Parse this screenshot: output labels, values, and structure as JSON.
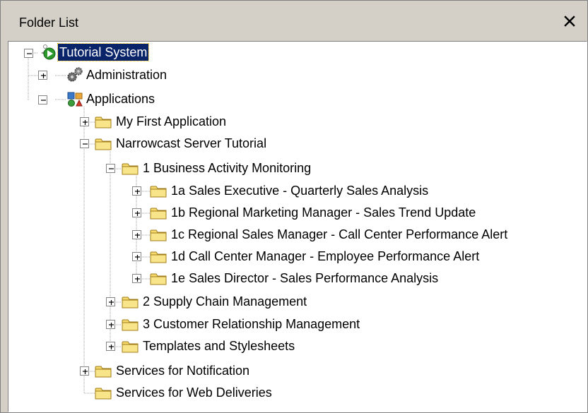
{
  "panel": {
    "title": "Folder List",
    "close_glyph": "✕"
  },
  "tree": {
    "root": {
      "label": "Tutorial System",
      "icon": "system-icon",
      "expanded": true,
      "selected": true
    },
    "administration": {
      "label": "Administration",
      "icon": "gears-icon",
      "expanded": false
    },
    "applications": {
      "label": "Applications",
      "icon": "applications-icon",
      "expanded": true
    },
    "my_first_application": {
      "label": "My First Application",
      "icon": "folder-icon",
      "expanded": false
    },
    "narrowcast_server_tutorial": {
      "label": "Narrowcast Server Tutorial",
      "icon": "folder-icon",
      "expanded": true
    },
    "business_activity_monitoring": {
      "label": "1 Business Activity Monitoring",
      "icon": "folder-icon",
      "expanded": true
    },
    "bam_items": [
      {
        "label": "1a Sales Executive - Quarterly Sales Analysis",
        "icon": "folder-icon",
        "expanded": false
      },
      {
        "label": "1b Regional Marketing Manager - Sales Trend Update",
        "icon": "folder-icon",
        "expanded": false
      },
      {
        "label": "1c Regional Sales Manager - Call Center Performance Alert",
        "icon": "folder-icon",
        "expanded": false
      },
      {
        "label": "1d Call Center Manager - Employee Performance Alert",
        "icon": "folder-icon",
        "expanded": false
      },
      {
        "label": "1e Sales Director - Sales Performance Analysis",
        "icon": "folder-icon",
        "expanded": false
      }
    ],
    "supply_chain": {
      "label": "2 Supply Chain Management",
      "icon": "folder-icon",
      "expanded": false
    },
    "crm": {
      "label": "3 Customer Relationship Management",
      "icon": "folder-icon",
      "expanded": false
    },
    "templates": {
      "label": "Templates and Stylesheets",
      "icon": "folder-icon",
      "expanded": false
    },
    "services_notification": {
      "label": "Services for Notification",
      "icon": "folder-icon",
      "expanded": false
    },
    "services_web": {
      "label": "Services for Web Deliveries",
      "icon": "folder-icon"
    }
  },
  "colors": {
    "selection_bg": "#0a246a",
    "selection_fg": "#ffffff",
    "folder_fill": "#f5d96b",
    "folder_edge": "#a07c1a",
    "tree_line": "#a0a0a0"
  }
}
